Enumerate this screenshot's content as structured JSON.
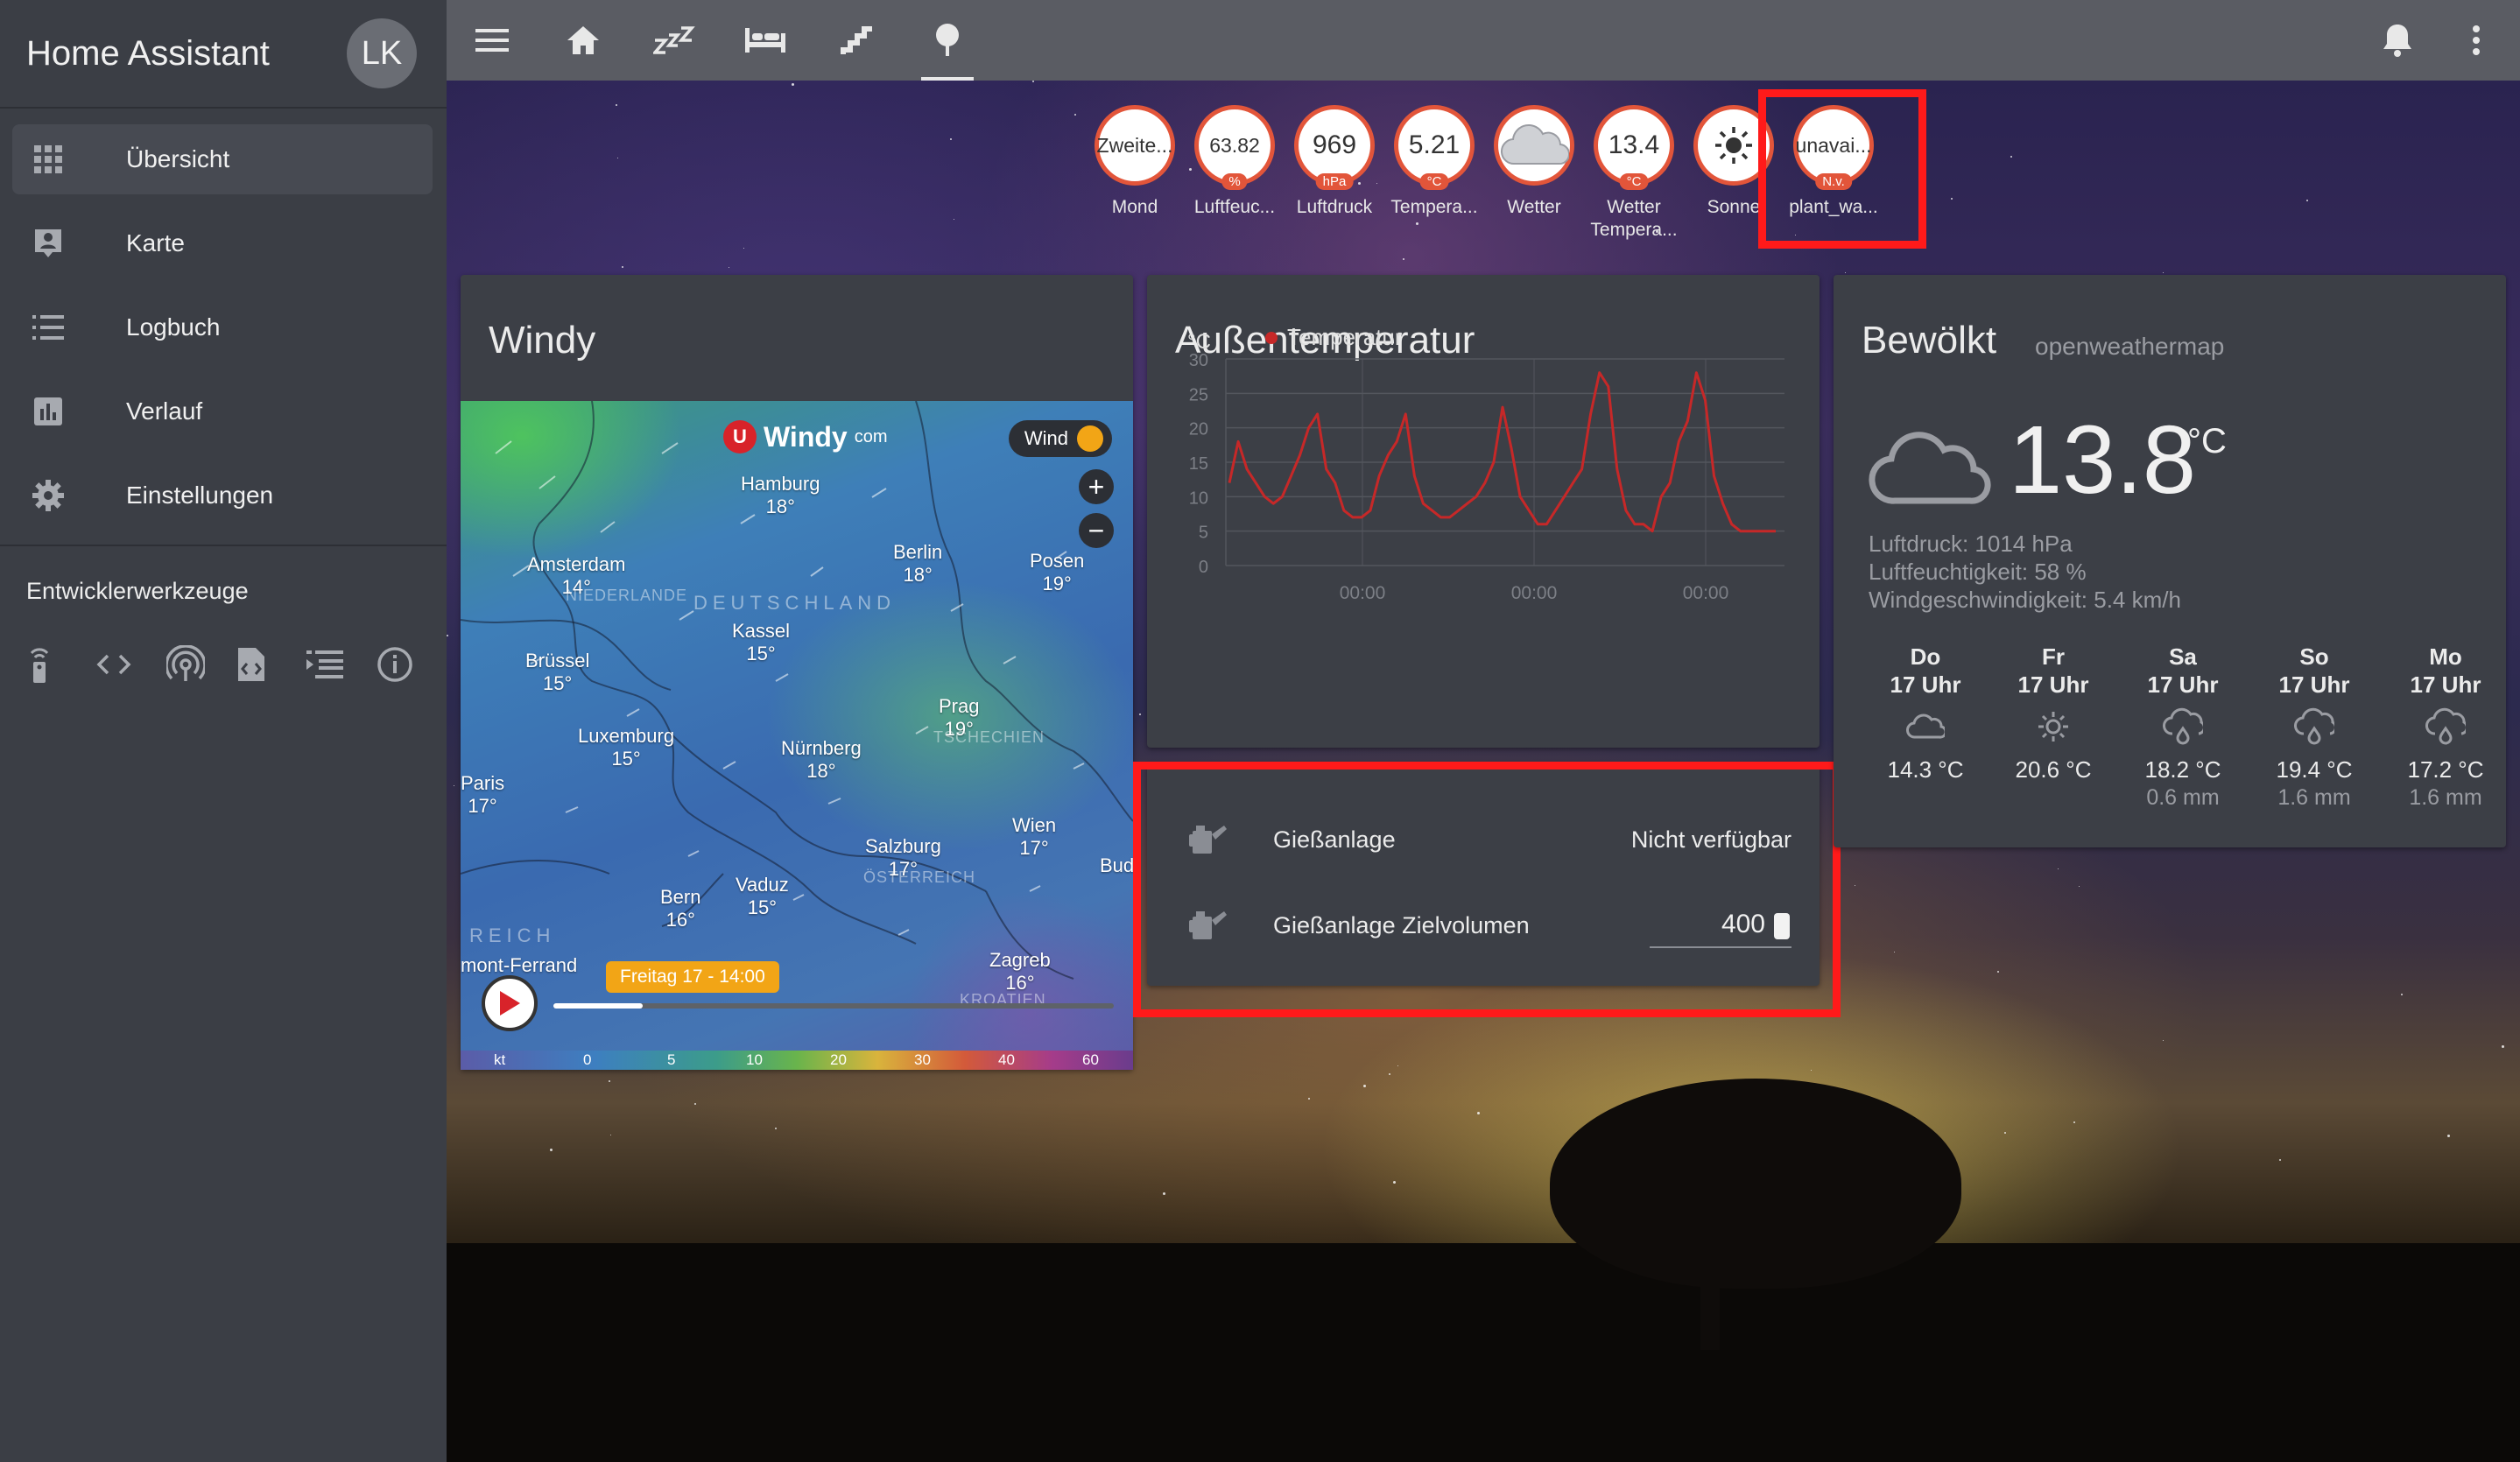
{
  "app": {
    "title": "Home Assistant",
    "avatar": "LK"
  },
  "sidebar": {
    "items": [
      {
        "label": "Übersicht",
        "icon": "grid-icon"
      },
      {
        "label": "Karte",
        "icon": "map-account-icon"
      },
      {
        "label": "Logbuch",
        "icon": "list-icon"
      },
      {
        "label": "Verlauf",
        "icon": "chart-icon"
      },
      {
        "label": "Einstellungen",
        "icon": "gear-icon"
      }
    ],
    "dev_title": "Entwicklerwerkzeuge",
    "dev_icons": [
      "remote-icon",
      "code-icon",
      "broadcast-icon",
      "file-code-icon",
      "template-icon",
      "info-icon"
    ]
  },
  "topbar": {
    "views": [
      "menu-icon",
      "home-icon",
      "sleep-icon",
      "bed-icon",
      "stairs-icon",
      "tree-icon"
    ],
    "active_view": 5
  },
  "badges": [
    {
      "value": "Zweite...",
      "unit": "",
      "label": "Mond"
    },
    {
      "value": "63.82",
      "unit": "%",
      "label": "Luftfeuc..."
    },
    {
      "value": "969",
      "unit": "hPa",
      "label": "Luftdruck"
    },
    {
      "value": "5.21",
      "unit": "°C",
      "label": "Tempera..."
    },
    {
      "value": "",
      "unit": "",
      "label": "Wetter",
      "icon": "cloud-icon"
    },
    {
      "value": "13.4",
      "unit": "°C",
      "label": "Wetter Tempera..."
    },
    {
      "value": "",
      "unit": "",
      "label": "Sonne",
      "icon": "sun-icon"
    },
    {
      "value": "unavai...",
      "unit": "N.v.",
      "label": "plant_wa..."
    }
  ],
  "windy": {
    "title": "Windy",
    "logo": "Windy",
    "logo_suffix": "com",
    "layer": "Wind",
    "time": "Freitag 17 - 14:00",
    "progress": 0.16,
    "scale_label": "kt",
    "scale": [
      "0",
      "5",
      "10",
      "20",
      "30",
      "40",
      "60"
    ],
    "cities": [
      {
        "name": "Hamburg",
        "temp": "18°"
      },
      {
        "name": "Amsterdam",
        "temp": "14°"
      },
      {
        "name": "Berlin",
        "temp": "18°"
      },
      {
        "name": "Posen",
        "temp": "19°"
      },
      {
        "name": "Kassel",
        "temp": "15°"
      },
      {
        "name": "Brüssel",
        "temp": "15°"
      },
      {
        "name": "Prag",
        "temp": "19°"
      },
      {
        "name": "Luxemburg",
        "temp": "15°"
      },
      {
        "name": "Nürnberg",
        "temp": "18°"
      },
      {
        "name": "Paris",
        "temp": "17°"
      },
      {
        "name": "Wien",
        "temp": "17°"
      },
      {
        "name": "Salzburg",
        "temp": "17°"
      },
      {
        "name": "Bern",
        "temp": "16°"
      },
      {
        "name": "Vaduz",
        "temp": "15°"
      },
      {
        "name": "Zagreb",
        "temp": "16°"
      }
    ],
    "regions": [
      "DEUTSCHLAND",
      "NIEDERLANDE",
      "TSCHECHIEN",
      "ÖSTERREICH",
      "KROATIEN",
      "REICH",
      "mont-Ferrand",
      "Bud"
    ]
  },
  "temperature_card": {
    "title": "Außentemperatur"
  },
  "chart_data": {
    "type": "line",
    "title": "",
    "ylabel": "°C",
    "ylim": [
      0,
      30
    ],
    "yticks": [
      0,
      5,
      10,
      15,
      20,
      25,
      30
    ],
    "xticks": [
      "00:00",
      "00:00",
      "00:00"
    ],
    "grid": true,
    "legend": "top-left",
    "series": [
      {
        "name": "Temperatur",
        "color": "#c62828",
        "y": [
          12,
          18,
          14,
          12,
          10,
          9,
          10,
          13,
          16,
          20,
          22,
          14,
          12,
          8,
          7,
          7,
          8,
          13,
          16,
          18,
          22,
          13,
          9,
          8,
          7,
          7,
          8,
          9,
          10,
          12,
          15,
          23,
          17,
          10,
          8,
          6,
          6,
          8,
          10,
          12,
          14,
          22,
          28,
          26,
          14,
          8,
          6,
          6,
          5,
          10,
          12,
          18,
          21,
          28,
          24,
          13,
          9,
          6,
          5,
          5,
          5,
          5,
          5
        ]
      }
    ]
  },
  "entities": [
    {
      "icon": "watering-can-icon",
      "name": "Gießanlage",
      "state": "Nicht verfügbar"
    },
    {
      "icon": "watering-can-icon",
      "name": "Gießanlage Zielvolumen",
      "value": "400"
    }
  ],
  "weather": {
    "condition": "Bewölkt",
    "source": "openweathermap",
    "temp": "13.8",
    "unit": "°C",
    "attributes": [
      "Luftdruck: 1014 hPa",
      "Luftfeuchtigkeit: 58 %",
      "Windgeschwindigkeit: 5.4 km/h"
    ],
    "forecast": [
      {
        "day": "Do",
        "time": "17 Uhr",
        "icon": "cloud-icon",
        "temp": "14.3 °C",
        "precip": ""
      },
      {
        "day": "Fr",
        "time": "17 Uhr",
        "icon": "sun-icon",
        "temp": "20.6 °C",
        "precip": ""
      },
      {
        "day": "Sa",
        "time": "17 Uhr",
        "icon": "rain-icon",
        "temp": "18.2 °C",
        "precip": "0.6 mm"
      },
      {
        "day": "So",
        "time": "17 Uhr",
        "icon": "rain-icon",
        "temp": "19.4 °C",
        "precip": "1.6 mm"
      },
      {
        "day": "Mo",
        "time": "17 Uhr",
        "icon": "rain-icon",
        "temp": "17.2 °C",
        "precip": "1.6 mm"
      }
    ]
  },
  "colors": {
    "accent": "#e2553a",
    "highlight": "#ff1a1a",
    "sidebar": "#3b3e45",
    "card": "#3c3f46"
  }
}
